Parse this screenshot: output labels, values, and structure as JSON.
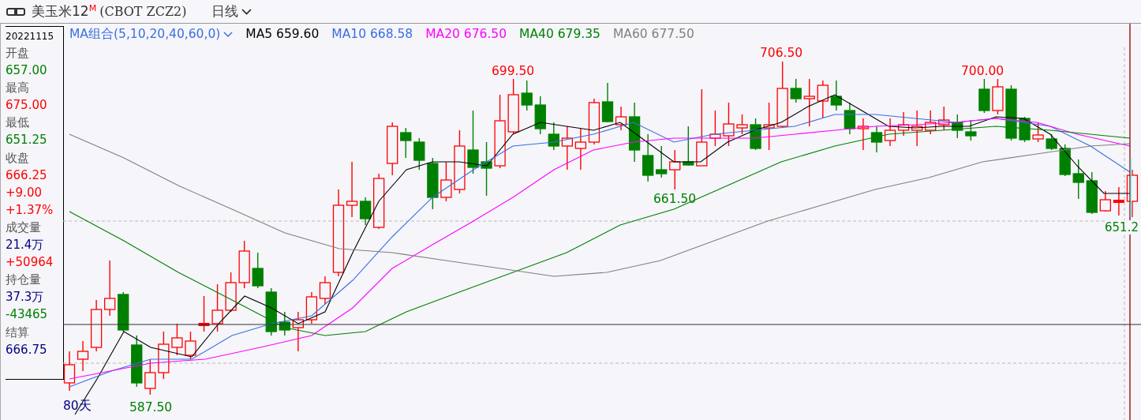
{
  "header": {
    "title": "美玉米12",
    "title_mark": "M",
    "code": "(CBOT ZCZ2)",
    "period": "日线"
  },
  "info_panel": {
    "date": "20221115",
    "items": [
      {
        "kind": "label",
        "text": "开盘"
      },
      {
        "kind": "value",
        "text": "657.00",
        "color": "#008000"
      },
      {
        "kind": "label",
        "text": "最高"
      },
      {
        "kind": "value",
        "text": "675.00",
        "color": "#ff0000"
      },
      {
        "kind": "label",
        "text": "最低"
      },
      {
        "kind": "value",
        "text": "651.25",
        "color": "#008000"
      },
      {
        "kind": "label",
        "text": "收盘"
      },
      {
        "kind": "value",
        "text": "666.25",
        "color": "#ff0000"
      },
      {
        "kind": "value",
        "text": "+9.00",
        "color": "#ff0000"
      },
      {
        "kind": "value",
        "text": "+1.37%",
        "color": "#ff0000"
      },
      {
        "kind": "label",
        "text": "成交量"
      },
      {
        "kind": "value",
        "text": "21.4万",
        "color": "#000080"
      },
      {
        "kind": "value",
        "text": "+50964",
        "color": "#ff0000"
      },
      {
        "kind": "label",
        "text": "持仓量"
      },
      {
        "kind": "value",
        "text": "37.3万",
        "color": "#000080"
      },
      {
        "kind": "value",
        "text": "-43465",
        "color": "#008000"
      },
      {
        "kind": "label",
        "text": "结算"
      },
      {
        "kind": "value",
        "text": "666.75",
        "color": "#000080"
      }
    ]
  },
  "legend": {
    "indicator": "MA组合(5,10,20,40,60,0)",
    "lines": [
      {
        "name": "MA5",
        "value": "659.60",
        "color": "#000000"
      },
      {
        "name": "MA10",
        "value": "668.58",
        "color": "#3a6fe0"
      },
      {
        "name": "MA20",
        "value": "676.50",
        "color": "#ff00ff"
      },
      {
        "name": "MA40",
        "value": "679.35",
        "color": "#008000"
      },
      {
        "name": "MA60",
        "value": "677.50",
        "color": "#808080"
      }
    ]
  },
  "price_labels": [
    {
      "text": "699.50",
      "color": "#ff0000"
    },
    {
      "text": "706.50",
      "color": "#ff0000"
    },
    {
      "text": "700.00",
      "color": "#ff0000"
    },
    {
      "text": "661.50",
      "color": "#008000"
    },
    {
      "text": "587.50",
      "color": "#008000"
    },
    {
      "text": "651.2",
      "color": "#008000"
    }
  ],
  "range_label": "80天"
}
